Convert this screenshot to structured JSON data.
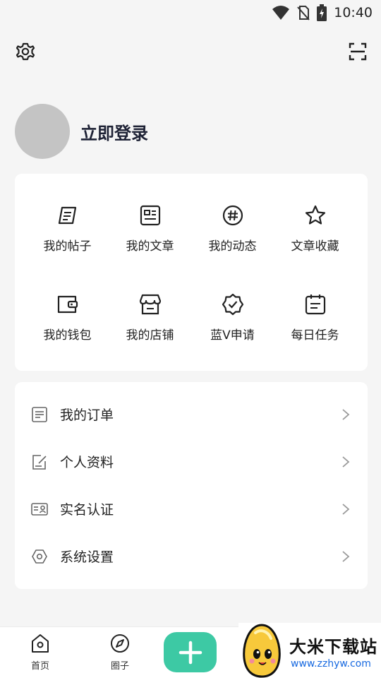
{
  "status_bar": {
    "time": "10:40",
    "icons": [
      "wifi-icon",
      "no-sim-icon",
      "battery-charging-icon"
    ]
  },
  "header": {
    "left_icon": "settings-gear-icon",
    "right_icon": "scan-icon"
  },
  "profile": {
    "login_label": "立即登录"
  },
  "grid": [
    {
      "label": "我的帖子",
      "icon": "post-icon"
    },
    {
      "label": "我的文章",
      "icon": "article-icon"
    },
    {
      "label": "我的动态",
      "icon": "hashtag-icon"
    },
    {
      "label": "文章收藏",
      "icon": "star-icon"
    },
    {
      "label": "我的钱包",
      "icon": "wallet-icon"
    },
    {
      "label": "我的店铺",
      "icon": "store-icon"
    },
    {
      "label": "蓝V申请",
      "icon": "verified-badge-icon"
    },
    {
      "label": "每日任务",
      "icon": "calendar-task-icon"
    }
  ],
  "menu": [
    {
      "label": "我的订单",
      "icon": "order-list-icon"
    },
    {
      "label": "个人资料",
      "icon": "edit-profile-icon"
    },
    {
      "label": "实名认证",
      "icon": "id-card-icon"
    },
    {
      "label": "系统设置",
      "icon": "hexagon-settings-icon"
    }
  ],
  "bottom_nav": [
    {
      "label": "首页",
      "icon": "home-icon"
    },
    {
      "label": "圈子",
      "icon": "compass-icon"
    }
  ],
  "fab": {
    "icon": "plus-icon"
  },
  "watermark": {
    "title": "大米下载站",
    "url": "www.zzhyw.com"
  },
  "colors": {
    "accent": "#3dc9a4",
    "background": "#f5f5f5",
    "card": "#ffffff",
    "text_dark": "#1e2235"
  }
}
